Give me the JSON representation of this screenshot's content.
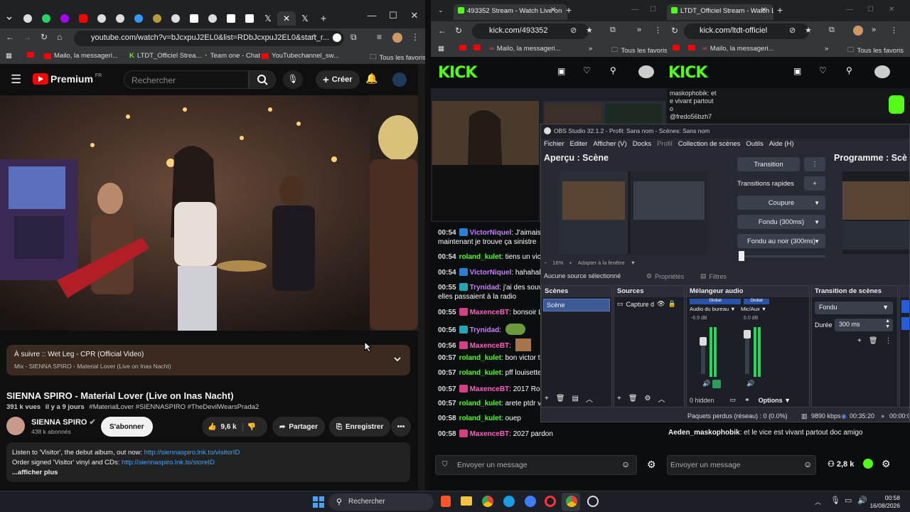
{
  "youtube": {
    "url": "youtube.com/watch?v=bJcxpuJ2EL0&list=RDbJcxpuJ2EL0&start_r...",
    "bookmarks": [
      "Mailo, la messageri...",
      "LTDT_Officiel Strea...",
      "Team one - Chat",
      "YouTubechannel_sw...",
      "Tous les favoris"
    ],
    "logo_text": "Premium",
    "logo_region": "FR",
    "search_placeholder": "Rechercher",
    "create_label": "Créer",
    "up_next_title": "À suivre :: Wet Leg - CPR (Official Video)",
    "up_next_sub": "Mix - SIENNA SPIRO - Material Lover (Live on Inas Nacht)",
    "video_title": "SIENNA SPIRO - Material Lover (Live on Inas Nacht)",
    "views": "391 k vues",
    "age": "il y a 9 jours",
    "hashtags": "#MaterialLover #SIENNASPIRO #TheDevilWearsPrada2",
    "channel": "SIENNA SPIRO",
    "subscribers": "438 k abonnés",
    "subscribe_label": "S'abonner",
    "likes": "9,6 k",
    "share_label": "Partager",
    "save_label": "Enregistrer",
    "desc_line1": "Listen to 'Visitor', the debut album, out now:",
    "desc_link1": "http://siennaspiro.lnk.to/visitorID",
    "desc_line2": "Order signed 'Visitor' vinyl and CDs:",
    "desc_link2": "http://siennaspiro.lnk.to/storeID",
    "desc_more": "...afficher plus"
  },
  "kick1": {
    "tab_title": "493352 Stream - Watch Live on",
    "url": "kick.com/493352",
    "bookmarks": [
      "Mailo, la messageri...",
      "Tous les favoris"
    ],
    "logo": "KICK",
    "chat": [
      {
        "time": "00:54",
        "user": "VictorNiquel",
        "color": "#c77dff",
        "text": ": J'aimais"
      },
      {
        "time": "",
        "user": "",
        "color": "#fff",
        "text": "maintenant je trouve ça sinistre"
      },
      {
        "time": "00:54",
        "user": "roland_kulet",
        "color": "#53fc18",
        "text": ": tiens un vict"
      },
      {
        "time": "00:54",
        "user": "VictorNiquel",
        "color": "#c77dff",
        "text": ": hahahah"
      },
      {
        "time": "00:55",
        "user": "Trynidad",
        "color": "#c77dff",
        "text": ": j'ai des souv"
      },
      {
        "time": "",
        "user": "",
        "color": "#fff",
        "text": "elles passaient à la radio"
      },
      {
        "time": "00:55",
        "user": "MaxenceBT",
        "color": "#ff5fc3",
        "text": ": bonsoir L"
      },
      {
        "time": "00:56",
        "user": "Trynidad",
        "color": "#c77dff",
        "text": ":"
      },
      {
        "time": "00:56",
        "user": "MaxenceBT",
        "color": "#ff5fc3",
        "text": ":"
      },
      {
        "time": "00:57",
        "user": "roland_kulet",
        "color": "#53fc18",
        "text": ": bon victor to"
      },
      {
        "time": "00:57",
        "user": "roland_kulet",
        "color": "#53fc18",
        "text": ": pff louisette"
      },
      {
        "time": "00:57",
        "user": "MaxenceBT",
        "color": "#ff5fc3",
        "text": ": 2017 Rol"
      },
      {
        "time": "00:57",
        "user": "roland_kulet",
        "color": "#53fc18",
        "text": ": arete ptdr ve"
      },
      {
        "time": "00:58",
        "user": "roland_kulet",
        "color": "#53fc18",
        "text": ": ouep"
      },
      {
        "time": "00:58",
        "user": "MaxenceBT",
        "color": "#ff5fc3",
        "text": ": 2027 pardon"
      }
    ],
    "message_placeholder": "Envoyer un message"
  },
  "kick2": {
    "tab_title": "LTDT_Officiel Stream - Watch Li",
    "url": "kick.com/ltdt-officiel",
    "bookmarks": [
      "Mailo, la messageri...",
      "Tous les favoris"
    ],
    "logo": "KICK",
    "top_chat": [
      "maskophobik: et",
      "e vivant partout",
      "o",
      "@fredo56bzh7"
    ],
    "chat_user": "Aeden_maskophobik",
    "chat_text": ": et le vice est vivant partout doc amigo",
    "message_placeholder": "Envoyer un message",
    "viewers": "2,8 k"
  },
  "obs": {
    "title": "OBS Studio 32.1.2 - Profil: Sans nom - Scènes: Sans nom",
    "menu": [
      "Fichier",
      "Editer",
      "Afficher (V)",
      "Docks",
      "Profil",
      "Collection de scènes",
      "Outils",
      "Aide (H)"
    ],
    "preview_label": "Aperçu : Scène",
    "program_label": "Programme : Scè",
    "transition_label": "Transition",
    "quick_transitions": "Transitions rapides",
    "cut_label": "Coupure",
    "fade_label": "Fondu (300ms)",
    "fade_black_label": "Fondu au noir (300ms)",
    "zoom": "16%",
    "fit_label": "Adapter à la fenêtre",
    "no_source": "Aucune source sélectionné",
    "properties_label": "Propriétés",
    "filters_label": "Filtres",
    "scenes_title": "Scènes",
    "scene_item": "Scène",
    "sources_title": "Sources",
    "source_item": "Capture d",
    "mixer_title": "Mélangeur audio",
    "mixer_global1": "Global",
    "mixer_global2": "Global",
    "mixer_ch1": "Audio du bureau",
    "mixer_ch2": "Mic/Aux",
    "mixer_db1": "-6.9 dB",
    "mixer_db2": "6.0 dB",
    "mixer_hidden": "0 hidden",
    "options_label": "Options",
    "transitions_title": "Transition de scènes",
    "transition_type": "Fondu",
    "duration_label": "Durée",
    "duration_value": "300 ms",
    "dropped": "Paquets perdus (réseau) : 0 (0.0%)",
    "bitrate": "9890 kbps",
    "rec_time": "00:35:20",
    "stream_time": "00:00:0"
  },
  "taskbar": {
    "search": "Rechercher",
    "time": "00:58",
    "date": "16/08/2026"
  }
}
